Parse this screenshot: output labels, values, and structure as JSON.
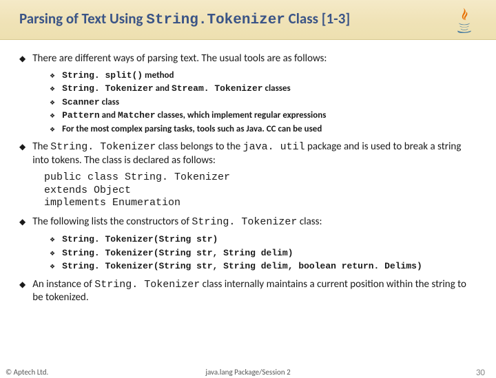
{
  "header": {
    "title_pre": "Parsing of Text Using ",
    "title_mono": "String.Tokenizer",
    "title_post": " Class [1-3]"
  },
  "bullets": {
    "b1a": "There are different ways of parsing text. The usual tools are as follows:",
    "sub_a": [
      {
        "pre": "",
        "mono": "String. split()",
        "mid": "  method",
        "mono2": "",
        "post": ""
      },
      {
        "pre": "",
        "mono": "String. Tokenizer",
        "mid": " and ",
        "mono2": "Stream. Tokenizer",
        "post": " classes"
      },
      {
        "pre": "",
        "mono": "Scanner",
        "mid": " class",
        "mono2": "",
        "post": ""
      },
      {
        "pre": "",
        "mono": "Pattern",
        "mid": " and ",
        "mono2": "Matcher",
        "post": " classes, which implement regular expressions"
      },
      {
        "pre": "For the most complex parsing tasks, tools such as Java. CC can be used",
        "mono": "",
        "mid": "",
        "mono2": "",
        "post": ""
      }
    ],
    "b1b_pre": "The ",
    "b1b_mono1": "String. Tokenizer",
    "b1b_mid": " class belongs to the ",
    "b1b_mono2": "java. util",
    "b1b_post": " package and is used to break a string into tokens. The class is declared as follows:",
    "code": [
      "public class String. Tokenizer",
      "extends Object",
      "implements Enumeration"
    ],
    "b1c_pre": "The following lists the constructors of ",
    "b1c_mono": "String. Tokenizer",
    "b1c_post": " class:",
    "sub_c": [
      "String. Tokenizer(String str)",
      "String. Tokenizer(String str, String delim)",
      "String. Tokenizer(String str, String delim, boolean return. Delims)"
    ],
    "b1d_pre": "An instance of ",
    "b1d_mono": "String. Tokenizer",
    "b1d_post": " class internally maintains a current position within the string to be tokenized."
  },
  "footer": {
    "left": "© Aptech Ltd.",
    "center": "java.lang Package/Session 2",
    "right": "30"
  }
}
